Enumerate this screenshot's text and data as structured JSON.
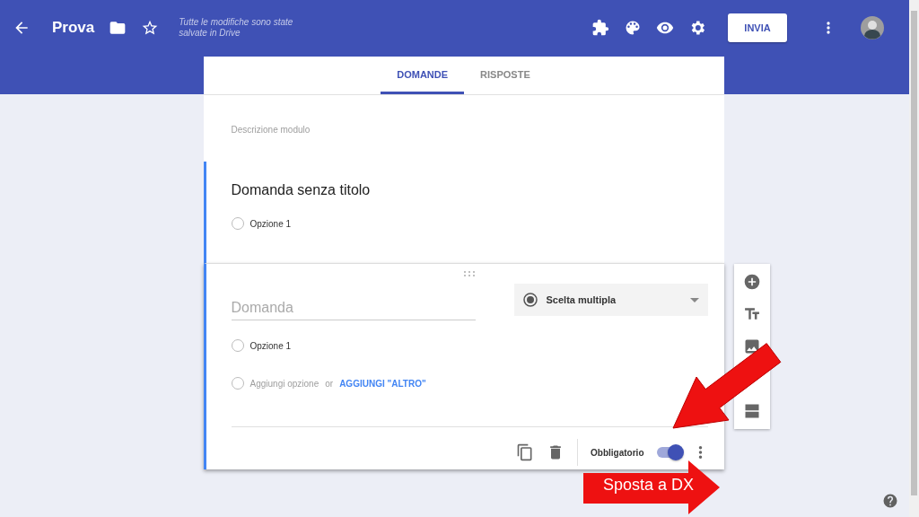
{
  "header": {
    "title": "Prova",
    "save_status": "Tutte le modifiche sono state salvate in Drive",
    "send_button": "INVIA"
  },
  "tabs": [
    {
      "label": "DOMANDE",
      "selected": true
    },
    {
      "label": "RISPOSTE",
      "selected": false
    }
  ],
  "form": {
    "description_placeholder": "Descrizione modulo"
  },
  "questions": [
    {
      "kind": "collapsed",
      "title": "Domanda senza titolo",
      "options": [
        {
          "label": "Opzione 1",
          "selected": false
        }
      ]
    },
    {
      "kind": "editing",
      "title_placeholder": "Domanda",
      "type": "Scelta multipla",
      "options": [
        {
          "label": "Opzione 1",
          "selected": false
        }
      ],
      "add_option": {
        "label": "Aggiungi opzione",
        "selected": false
      },
      "or": "or",
      "add_other": "AGGIUNGI \"ALTRO\"",
      "required_label": "Obbligatorio",
      "required": true
    }
  ],
  "annotation": {
    "label": "Sposta a DX"
  }
}
